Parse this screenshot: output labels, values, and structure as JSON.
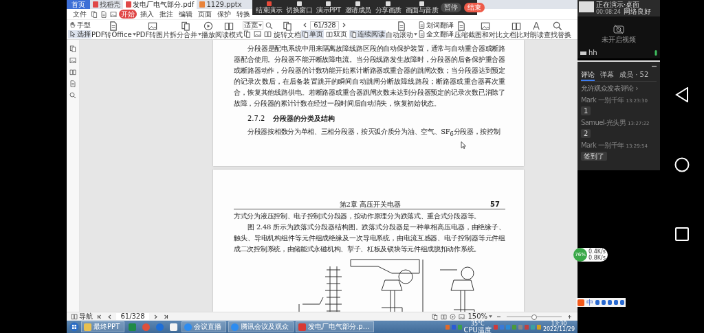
{
  "browser_tabs": [
    {
      "label": "首页",
      "kind": "home",
      "selected": false
    },
    {
      "label": "找稻壳",
      "kind": "web",
      "selected": false
    },
    {
      "label": "发电厂电气部分.pdf",
      "kind": "pdf",
      "selected": true
    },
    {
      "label": "1129.pptx",
      "kind": "ppt",
      "selected": false
    }
  ],
  "meeting_toolbar": {
    "actions": [
      {
        "label": "结束演示",
        "kind": "stop"
      },
      {
        "label": "切换窗口",
        "kind": "window"
      },
      {
        "label": "演示PPT",
        "kind": "ppt"
      },
      {
        "label": "邀请成员",
        "kind": "invite"
      },
      {
        "label": "分享画质",
        "kind": "quality"
      },
      {
        "label": "画面与音质",
        "kind": "sound"
      }
    ],
    "buttons": [
      {
        "label": "暂停",
        "kind": "pause"
      },
      {
        "label": "结束",
        "kind": "end"
      }
    ]
  },
  "menu": [
    {
      "label": "文件",
      "selected": false
    },
    {
      "label": "开始",
      "selected": true
    },
    {
      "label": "插入",
      "selected": false
    },
    {
      "label": "批注",
      "selected": false
    },
    {
      "label": "编辑",
      "selected": false
    },
    {
      "label": "页面",
      "selected": false
    },
    {
      "label": "保护",
      "selected": false
    },
    {
      "label": "转换",
      "selected": false
    }
  ],
  "toolbar": [
    {
      "kind": "pair",
      "items": [
        {
          "label": "手型",
          "selected": false
        },
        {
          "label": "选择",
          "selected": true
        }
      ]
    },
    {
      "kind": "big",
      "label": "PDF转Office",
      "dropdown": true
    },
    {
      "kind": "big",
      "label": "PDF转图片",
      "dropdown": false
    },
    {
      "kind": "big",
      "label": "拆分合并",
      "dropdown": true
    },
    {
      "kind": "big",
      "label": "播放",
      "dropdown": false
    },
    {
      "kind": "big",
      "label": "阅读模式",
      "dropdown": false
    },
    {
      "kind": "zoom",
      "value": "适宽"
    },
    {
      "kind": "big",
      "label": "旋转文档",
      "dropdown": false
    },
    {
      "kind": "nav",
      "page": "61/328",
      "modes": [
        {
          "label": "单页",
          "selected": true
        },
        {
          "label": "双页",
          "selected": false
        },
        {
          "label": "连续阅读",
          "selected": true
        }
      ]
    },
    {
      "kind": "big",
      "label": "自动滚动",
      "dropdown": true
    },
    {
      "kind": "pair",
      "items": [
        {
          "label": "划词翻译",
          "selected": false
        },
        {
          "label": "全文翻译",
          "selected": false
        }
      ]
    },
    {
      "kind": "big",
      "label": "压缩",
      "dropdown": false
    },
    {
      "kind": "big",
      "label": "截图和对比",
      "dropdown": false
    },
    {
      "kind": "big",
      "label": "文档比对",
      "dropdown": false
    },
    {
      "kind": "big",
      "label": "朗读",
      "dropdown": false
    },
    {
      "kind": "big",
      "label": "查找替换",
      "dropdown": false
    }
  ],
  "document": {
    "pages": [
      {
        "blocks": [
          {
            "kind": "paragraph",
            "text": "分段器是配电系统中用来隔离故障线路区段的自动保护装置，通常与自动重合器或断路器配合使用。分段器不能开断故障电流。当分段线路发生故障时，分段器的后备保护重合器或断路器动作，分段器的计数功能开始累计断路器或重合器的跳闸次数；当分段器达到预定的记录次数后，在后备装置跳开的瞬间自动跳闸分断故障线路段；断路器或重合器再次重合，恢复其他线路供电。若断路器或重合器跳闸次数未达到分段器预定的记录次数已消除了故障，分段器的累计计数在经过一段时间后自动消失，恢复初始状态。"
          },
          {
            "kind": "heading",
            "number": "2.7.2",
            "text": "分段器的分类及结构"
          },
          {
            "kind": "paragraph",
            "text": "分段器按相数分为单相、三相分段器，按灭弧介质分为油、空气、SF$_{6}$分段器，按控制"
          }
        ]
      },
      {
        "header": "第2章  高压开关电器",
        "page_number": "57",
        "blocks": [
          {
            "kind": "continuation",
            "text": "方式分为液压控制、电子控制式分段器，按动作原理分为跌落式、重合式分段器等。"
          },
          {
            "kind": "paragraph",
            "text": "图 2.48 所示为跌落式分段器结构图。跌落式分段器是一种单相高压电器，由绝缘子、触头、导电机构组件等元件组成绝缘及一次导电系统，由电流互感器、电子控制器等元件组成二次控制系统，由储能式永磁机构、掣子、杠板及锁块等元件组成脱扣动作系统。"
          },
          {
            "kind": "figure"
          }
        ]
      }
    ]
  },
  "status_bar": {
    "navigation": "导航",
    "page": "61/328",
    "zoom": "150%",
    "zoom_slider": {
      "level": 0.5
    }
  },
  "taskbar": {
    "apps": [
      {
        "kind": "folder",
        "label": "最终PPT"
      },
      {
        "kind": "excel"
      },
      {
        "kind": "chrome"
      },
      {
        "kind": "flash"
      },
      {
        "kind": "file"
      },
      {
        "kind": "meeting",
        "label": "会议直播"
      },
      {
        "kind": "meeting",
        "label": "腾讯会议及观众"
      },
      {
        "kind": "wps",
        "label": "发电厂电气部分.p..."
      }
    ],
    "temperature": "35°C",
    "temperature_label": "CPU温度",
    "time": "13:30",
    "date": "2022/11/29"
  },
  "ime_bar": {
    "mode": "中"
  },
  "network_widget": {
    "load": "76%",
    "upload": "0.4K/s",
    "download": "0.8K/s"
  },
  "video_tile": {
    "status": "正在演示·桌面",
    "duration": "00:08:24",
    "network": "网络良好",
    "camera": "未开启视频",
    "participant": "hh"
  },
  "chat_panel": {
    "tabs": [
      {
        "label": "评论",
        "selected": true
      },
      {
        "label": "弹幕",
        "selected": false
      },
      {
        "label": "成员 · 52",
        "selected": false
      }
    ],
    "permission": "允许观众发表评论 ›",
    "comments": [
      {
        "author": "Mark 一别千年",
        "time": "13:23:30",
        "text": "1"
      },
      {
        "author": "Samuel-光头男",
        "time": "13:27:22",
        "text": "2"
      },
      {
        "author": "Mark 一别千年",
        "time": "13:29:54",
        "text": "签到了"
      }
    ]
  }
}
